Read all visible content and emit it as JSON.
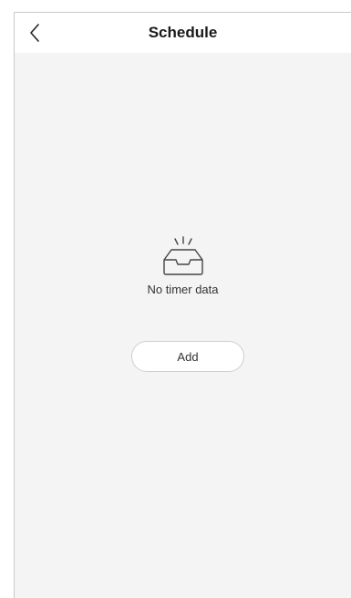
{
  "header": {
    "title": "Schedule",
    "back_icon": "chevron-left-icon"
  },
  "empty_state": {
    "icon": "empty-inbox-icon",
    "message": "No timer data"
  },
  "actions": {
    "add_label": "Add"
  },
  "colors": {
    "background": "#f4f4f4",
    "header_background": "#ffffff",
    "text_primary": "#1a1a1a",
    "text_secondary": "#333333",
    "button_border": "#cfcfcf"
  }
}
